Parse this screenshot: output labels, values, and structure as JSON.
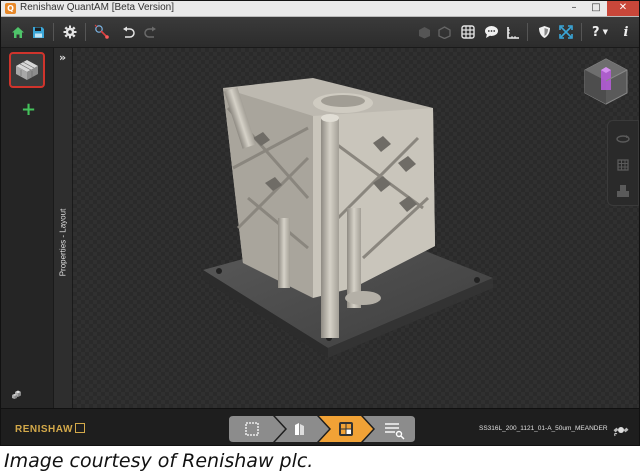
{
  "window": {
    "title": "Renishaw QuantAM [Beta Version]",
    "controls": {
      "minimize": "–",
      "maximize": "□",
      "close": "✕"
    }
  },
  "toolbar": {
    "left_icons": [
      "home-icon",
      "save-icon",
      "settings-icon",
      "laser-icon",
      "undo-icon",
      "redo-icon"
    ],
    "right_icons": [
      "object-icon",
      "object-outline-icon",
      "grid-icon",
      "comment-icon",
      "ruler-icon",
      "shield-icon",
      "fit-view-icon",
      "help-icon",
      "info-icon"
    ],
    "help_label": "?",
    "info_label": "i"
  },
  "sidebar": {
    "add_label": "+",
    "chevron": "»"
  },
  "properties_panel": {
    "label": "Properties - Layout"
  },
  "bottom": {
    "brand": "RENISHAW",
    "workflow_steps": [
      "layout-step",
      "supports-step",
      "slicing-step",
      "review-step"
    ],
    "active_step": 2,
    "build_file": "SS316L_200_1121_01-A_50um_MEANDER"
  },
  "caption": "Image courtesy of Renishaw plc.",
  "colors": {
    "accent_orange": "#f1a236",
    "add_green": "#44c25b",
    "close_red": "#c9473a",
    "brand_gold": "#d3a94a",
    "selection_red": "#d0342c"
  }
}
